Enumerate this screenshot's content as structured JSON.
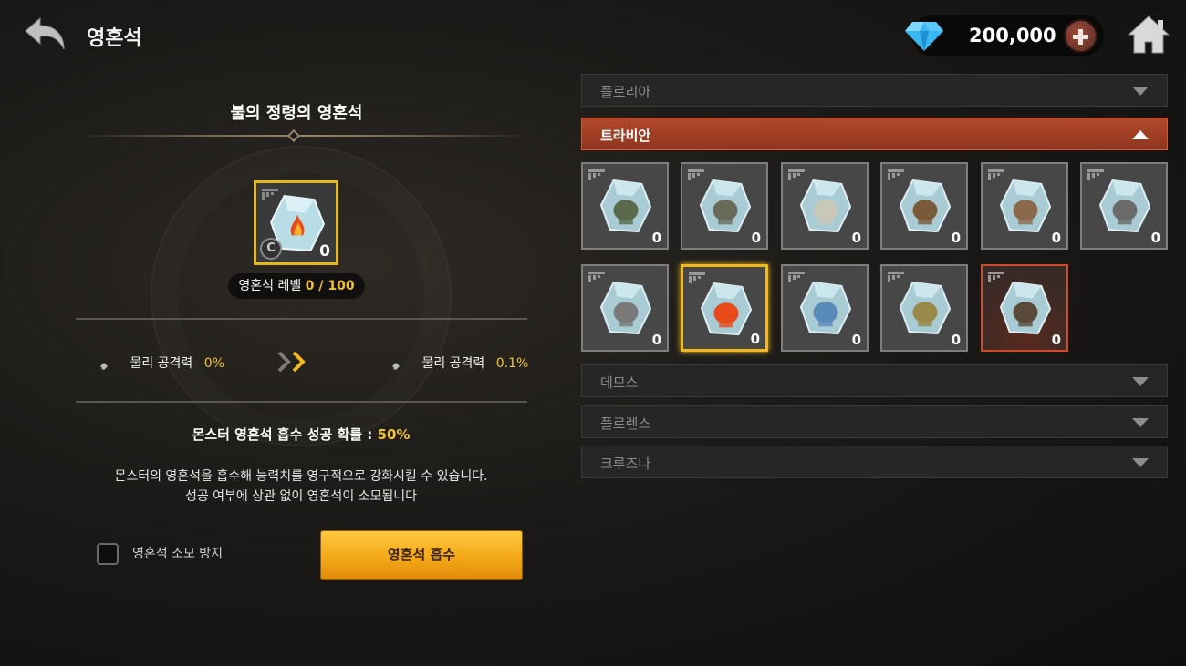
{
  "header": {
    "title": "영혼석",
    "currency_amount": "200,000",
    "icons": {
      "back": "back-arrow-icon",
      "gem": "gem-icon",
      "plus": "plus-icon",
      "home": "home-icon"
    }
  },
  "detail": {
    "stone_name": "불의 정령의 영혼석",
    "selected_count": "0",
    "grade_badge": "C",
    "level_label": "영혼석 레벨",
    "level_value": "0 / 100",
    "stat_current_label": "물리 공격력",
    "stat_current_value": "0%",
    "stat_next_label": "물리 공격력",
    "stat_next_value": "0.1%",
    "rate_label": "몬스터 영혼석 흡수 성공 확률 :",
    "rate_value": "50%",
    "desc_line1": "몬스터의 영혼석을 흡수해 능력치를 영구적으로 강화시킬 수 있습니다.",
    "desc_line2": "성공 여부에 상관 없이 영혼석이 소모됩니다",
    "prevent_label": "영혼석 소모 방지",
    "absorb_button": "영혼석 흡수"
  },
  "regions": [
    {
      "name": "플로리아",
      "expanded": false
    },
    {
      "name": "트라비안",
      "expanded": true
    },
    {
      "name": "데모스",
      "expanded": false
    },
    {
      "name": "플로렌스",
      "expanded": false
    },
    {
      "name": "크루즈나",
      "expanded": false
    }
  ],
  "stones": [
    {
      "monster": "zombie",
      "count": "0",
      "state": "normal",
      "color": "#5a6a4a"
    },
    {
      "monster": "ghoul",
      "count": "0",
      "state": "normal",
      "color": "#6a6a5a"
    },
    {
      "monster": "yeti",
      "count": "0",
      "state": "normal",
      "color": "#c8c8b8"
    },
    {
      "monster": "boar",
      "count": "0",
      "state": "normal",
      "color": "#7a5a3a"
    },
    {
      "monster": "bear",
      "count": "0",
      "state": "normal",
      "color": "#8a6a4a"
    },
    {
      "monster": "anvil",
      "count": "0",
      "state": "normal",
      "color": "#6a6a6a"
    },
    {
      "monster": "hammer",
      "count": "0",
      "state": "normal",
      "color": "#7a7a7a"
    },
    {
      "monster": "fire-spirit",
      "count": "0",
      "state": "selected",
      "color": "#e84a1a"
    },
    {
      "monster": "ice-cone",
      "count": "0",
      "state": "normal",
      "color": "#5a8ab8"
    },
    {
      "monster": "golem",
      "count": "0",
      "state": "normal",
      "color": "#9a8a4a"
    },
    {
      "monster": "warrior",
      "count": "0",
      "state": "rare",
      "color": "#5a4a3a"
    }
  ]
}
